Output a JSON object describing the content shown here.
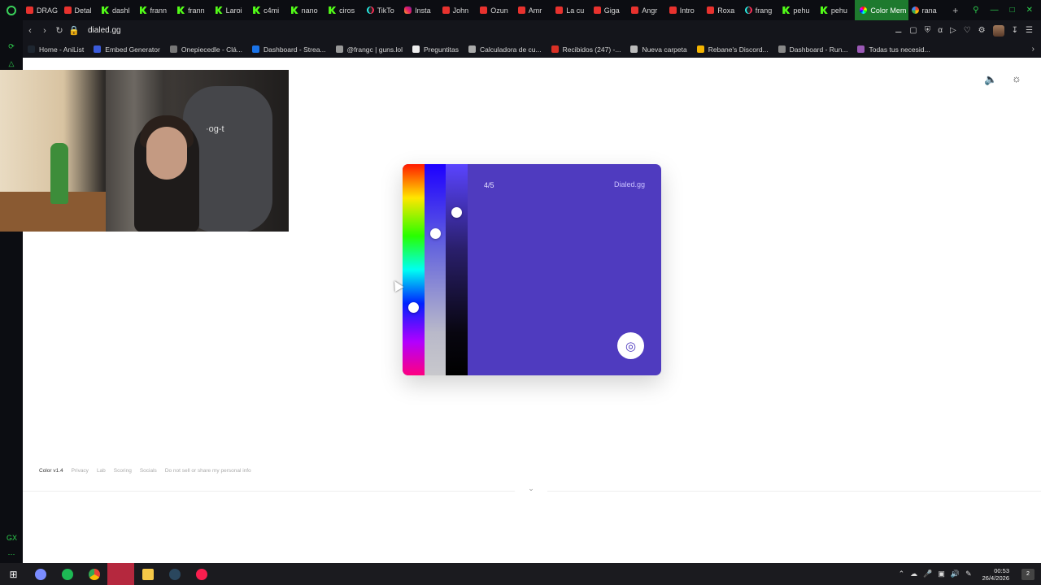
{
  "browser": {
    "tabs": [
      {
        "label": "DRAG",
        "icon": "youtube-icon"
      },
      {
        "label": "Detal",
        "icon": "youtube-icon"
      },
      {
        "label": "dashl",
        "icon": "kick-icon"
      },
      {
        "label": "frann",
        "icon": "kick-icon"
      },
      {
        "label": "frann",
        "icon": "kick-icon"
      },
      {
        "label": "Laroi",
        "icon": "kick-icon"
      },
      {
        "label": "c4mi",
        "icon": "kick-icon"
      },
      {
        "label": "nano",
        "icon": "kick-icon"
      },
      {
        "label": "ciros",
        "icon": "kick-icon"
      },
      {
        "label": "TikTo",
        "icon": "tiktok-icon"
      },
      {
        "label": "Insta",
        "icon": "instagram-icon"
      },
      {
        "label": "John",
        "icon": "youtube-icon"
      },
      {
        "label": "Ozun",
        "icon": "youtube-icon"
      },
      {
        "label": "Amr",
        "icon": "youtube-icon"
      },
      {
        "label": "La cu",
        "icon": "youtube-icon"
      },
      {
        "label": "Giga",
        "icon": "youtube-icon"
      },
      {
        "label": "Angr",
        "icon": "youtube-icon"
      },
      {
        "label": "Intro",
        "icon": "youtube-icon"
      },
      {
        "label": "Roxa",
        "icon": "youtube-icon"
      },
      {
        "label": "frang",
        "icon": "tiktok-icon"
      },
      {
        "label": "pehu",
        "icon": "kick-icon"
      },
      {
        "label": "pehu",
        "icon": "kick-icon"
      },
      {
        "label": "Color Mem",
        "icon": "color-wheel-icon",
        "active": true
      },
      {
        "label": "rana",
        "icon": "google-icon"
      }
    ],
    "new_tab": "+",
    "url": "dialed.gg",
    "bookmarks": [
      {
        "label": "Home - AniList",
        "color": "#1e2630"
      },
      {
        "label": "Embed Generator",
        "color": "#3b5bdb"
      },
      {
        "label": "Onepiecedle - Clá...",
        "color": "#777"
      },
      {
        "label": "Dashboard - Strea...",
        "color": "#1a73e8"
      },
      {
        "label": "@frangc | guns.lol",
        "color": "#999"
      },
      {
        "label": "Preguntitas",
        "color": "#eee"
      },
      {
        "label": "Calculadora de cu...",
        "color": "#aaa"
      },
      {
        "label": "Recibidos (247) -...",
        "color": "#d93025"
      },
      {
        "label": "Nueva carpeta",
        "color": "#bbb"
      },
      {
        "label": "Rebane's Discord...",
        "color": "#f4b400"
      },
      {
        "label": "Dashboard - Run...",
        "color": "#888"
      },
      {
        "label": "Todas tus necesid...",
        "color": "#9b59b6"
      }
    ]
  },
  "game": {
    "progress": "4/5",
    "brand": "Dialed.gg",
    "current_color": "#4f3bbf",
    "hue_level": 0.68,
    "saturation_level": 0.33,
    "lightness_level": 0.23
  },
  "footer": {
    "version": "Color v1.4",
    "links": [
      "Privacy",
      "Lab",
      "Scoring",
      "Socials",
      "Do not sell or share my personal info"
    ]
  },
  "taskbar": {
    "time": "00:53",
    "date": "26/4/2026",
    "notification_count": "2"
  }
}
